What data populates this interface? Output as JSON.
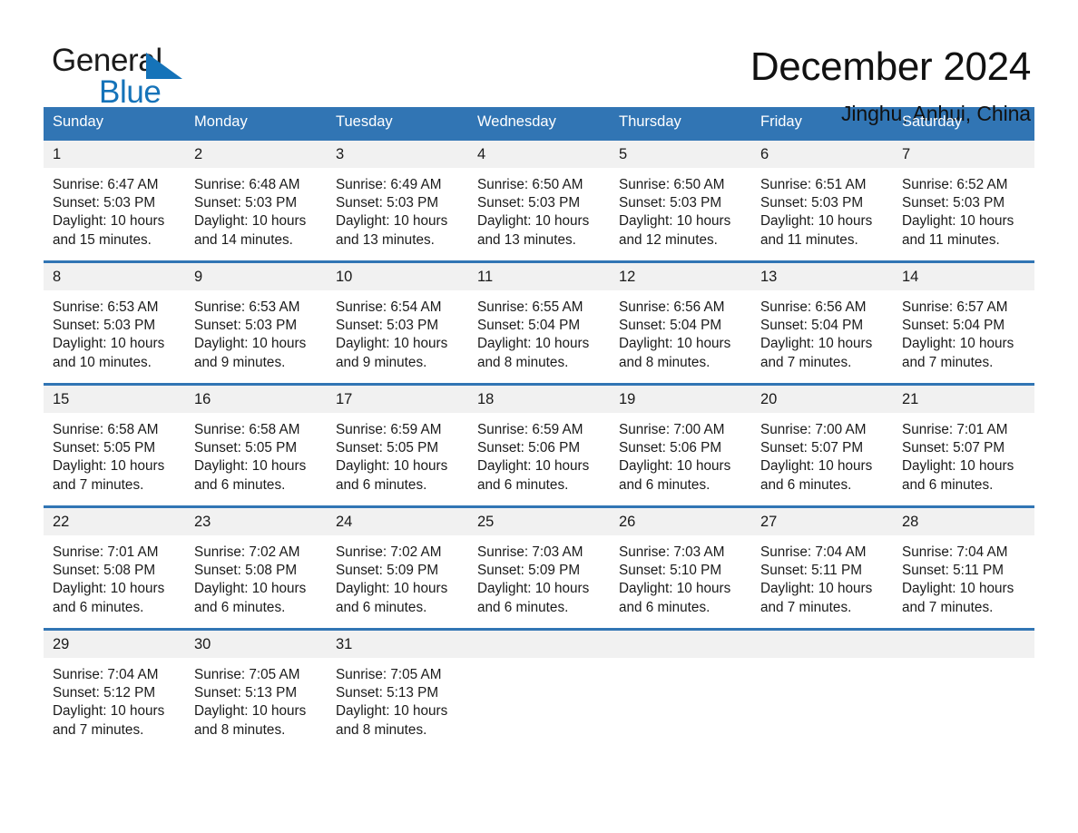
{
  "brand": {
    "name_part1": "General",
    "name_part2": "Blue",
    "accent_color": "#1573b9"
  },
  "header": {
    "month_title": "December 2024",
    "location": "Jinghu, Anhui, China"
  },
  "calendar": {
    "header_background": "#3175b4",
    "daynum_background": "#f1f1f1",
    "weekday_headers": [
      "Sunday",
      "Monday",
      "Tuesday",
      "Wednesday",
      "Thursday",
      "Friday",
      "Saturday"
    ],
    "weeks": [
      [
        {
          "day": "1",
          "info": "Sunrise: 6:47 AM\nSunset: 5:03 PM\nDaylight: 10 hours\nand 15 minutes."
        },
        {
          "day": "2",
          "info": "Sunrise: 6:48 AM\nSunset: 5:03 PM\nDaylight: 10 hours\nand 14 minutes."
        },
        {
          "day": "3",
          "info": "Sunrise: 6:49 AM\nSunset: 5:03 PM\nDaylight: 10 hours\nand 13 minutes."
        },
        {
          "day": "4",
          "info": "Sunrise: 6:50 AM\nSunset: 5:03 PM\nDaylight: 10 hours\nand 13 minutes."
        },
        {
          "day": "5",
          "info": "Sunrise: 6:50 AM\nSunset: 5:03 PM\nDaylight: 10 hours\nand 12 minutes."
        },
        {
          "day": "6",
          "info": "Sunrise: 6:51 AM\nSunset: 5:03 PM\nDaylight: 10 hours\nand 11 minutes."
        },
        {
          "day": "7",
          "info": "Sunrise: 6:52 AM\nSunset: 5:03 PM\nDaylight: 10 hours\nand 11 minutes."
        }
      ],
      [
        {
          "day": "8",
          "info": "Sunrise: 6:53 AM\nSunset: 5:03 PM\nDaylight: 10 hours\nand 10 minutes."
        },
        {
          "day": "9",
          "info": "Sunrise: 6:53 AM\nSunset: 5:03 PM\nDaylight: 10 hours\nand 9 minutes."
        },
        {
          "day": "10",
          "info": "Sunrise: 6:54 AM\nSunset: 5:03 PM\nDaylight: 10 hours\nand 9 minutes."
        },
        {
          "day": "11",
          "info": "Sunrise: 6:55 AM\nSunset: 5:04 PM\nDaylight: 10 hours\nand 8 minutes."
        },
        {
          "day": "12",
          "info": "Sunrise: 6:56 AM\nSunset: 5:04 PM\nDaylight: 10 hours\nand 8 minutes."
        },
        {
          "day": "13",
          "info": "Sunrise: 6:56 AM\nSunset: 5:04 PM\nDaylight: 10 hours\nand 7 minutes."
        },
        {
          "day": "14",
          "info": "Sunrise: 6:57 AM\nSunset: 5:04 PM\nDaylight: 10 hours\nand 7 minutes."
        }
      ],
      [
        {
          "day": "15",
          "info": "Sunrise: 6:58 AM\nSunset: 5:05 PM\nDaylight: 10 hours\nand 7 minutes."
        },
        {
          "day": "16",
          "info": "Sunrise: 6:58 AM\nSunset: 5:05 PM\nDaylight: 10 hours\nand 6 minutes."
        },
        {
          "day": "17",
          "info": "Sunrise: 6:59 AM\nSunset: 5:05 PM\nDaylight: 10 hours\nand 6 minutes."
        },
        {
          "day": "18",
          "info": "Sunrise: 6:59 AM\nSunset: 5:06 PM\nDaylight: 10 hours\nand 6 minutes."
        },
        {
          "day": "19",
          "info": "Sunrise: 7:00 AM\nSunset: 5:06 PM\nDaylight: 10 hours\nand 6 minutes."
        },
        {
          "day": "20",
          "info": "Sunrise: 7:00 AM\nSunset: 5:07 PM\nDaylight: 10 hours\nand 6 minutes."
        },
        {
          "day": "21",
          "info": "Sunrise: 7:01 AM\nSunset: 5:07 PM\nDaylight: 10 hours\nand 6 minutes."
        }
      ],
      [
        {
          "day": "22",
          "info": "Sunrise: 7:01 AM\nSunset: 5:08 PM\nDaylight: 10 hours\nand 6 minutes."
        },
        {
          "day": "23",
          "info": "Sunrise: 7:02 AM\nSunset: 5:08 PM\nDaylight: 10 hours\nand 6 minutes."
        },
        {
          "day": "24",
          "info": "Sunrise: 7:02 AM\nSunset: 5:09 PM\nDaylight: 10 hours\nand 6 minutes."
        },
        {
          "day": "25",
          "info": "Sunrise: 7:03 AM\nSunset: 5:09 PM\nDaylight: 10 hours\nand 6 minutes."
        },
        {
          "day": "26",
          "info": "Sunrise: 7:03 AM\nSunset: 5:10 PM\nDaylight: 10 hours\nand 6 minutes."
        },
        {
          "day": "27",
          "info": "Sunrise: 7:04 AM\nSunset: 5:11 PM\nDaylight: 10 hours\nand 7 minutes."
        },
        {
          "day": "28",
          "info": "Sunrise: 7:04 AM\nSunset: 5:11 PM\nDaylight: 10 hours\nand 7 minutes."
        }
      ],
      [
        {
          "day": "29",
          "info": "Sunrise: 7:04 AM\nSunset: 5:12 PM\nDaylight: 10 hours\nand 7 minutes."
        },
        {
          "day": "30",
          "info": "Sunrise: 7:05 AM\nSunset: 5:13 PM\nDaylight: 10 hours\nand 8 minutes."
        },
        {
          "day": "31",
          "info": "Sunrise: 7:05 AM\nSunset: 5:13 PM\nDaylight: 10 hours\nand 8 minutes."
        },
        {
          "day": "",
          "info": ""
        },
        {
          "day": "",
          "info": ""
        },
        {
          "day": "",
          "info": ""
        },
        {
          "day": "",
          "info": ""
        }
      ]
    ]
  }
}
